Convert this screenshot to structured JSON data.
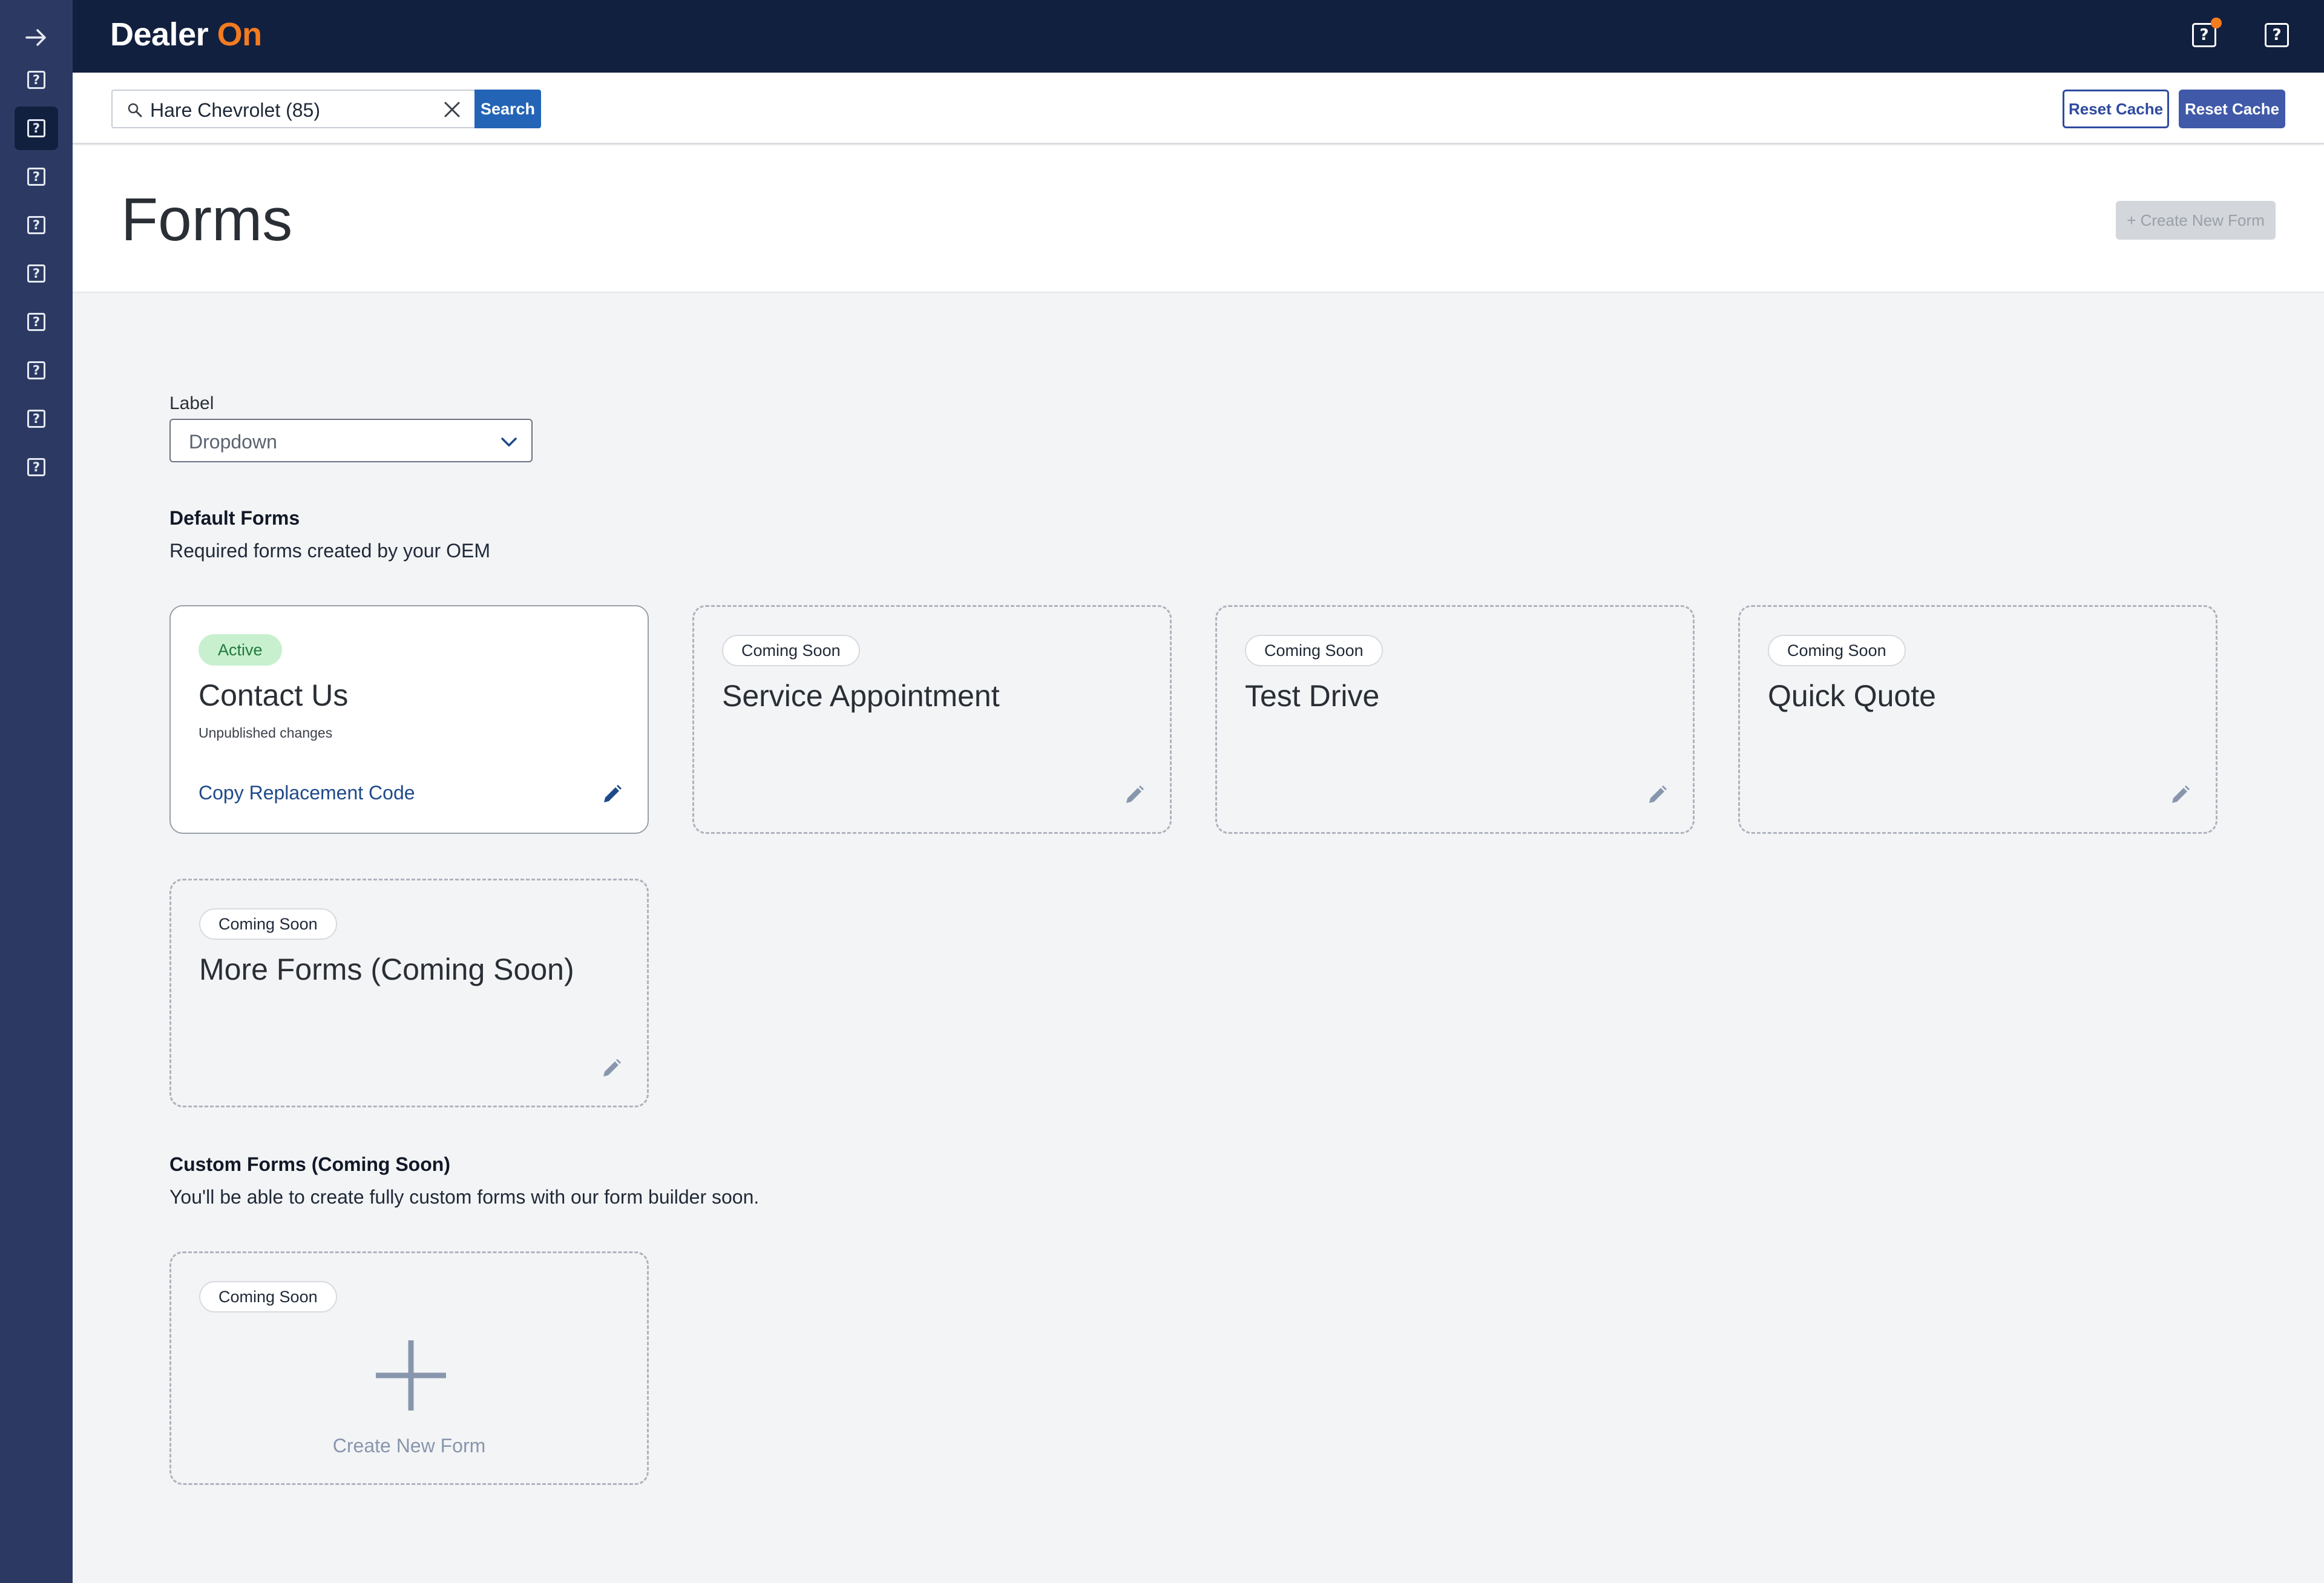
{
  "sidebar": {
    "collapse_icon": "arrow-right-icon",
    "item_icon": "help-square-icon",
    "item_count": 9,
    "active_index": 1
  },
  "header": {
    "logo_text_1": "Dealer",
    "logo_text_2": "On",
    "logo_colors": {
      "primary": "#ffffff",
      "accent": "#f47b20"
    },
    "icons": [
      "help-square-icon",
      "help-square-icon"
    ],
    "notification_dot_color": "#f47b20"
  },
  "search": {
    "value": "Hare Chevrolet (85)",
    "button_label": "Search"
  },
  "toolbar": {
    "reset_cache_label_1": "Reset Cache",
    "reset_cache_label_2": "Reset Cache"
  },
  "page": {
    "title": "Forms",
    "create_new_label": "+ Create New Form"
  },
  "filter": {
    "label": "Label",
    "dropdown_value": "Dropdown"
  },
  "default_forms": {
    "title": "Default Forms",
    "subtitle": "Required forms created by your OEM",
    "cards": [
      {
        "badge": "Active",
        "title": "Contact Us",
        "note": "Unpublished changes",
        "link": "Copy Replacement Code"
      },
      {
        "badge": "Coming Soon",
        "title": "Service Appointment"
      },
      {
        "badge": "Coming Soon",
        "title": "Test Drive"
      },
      {
        "badge": "Coming Soon",
        "title": "Quick Quote"
      },
      {
        "badge": "Coming Soon",
        "title": "More Forms (Coming Soon)"
      }
    ]
  },
  "custom_forms": {
    "title": "Custom Forms (Coming Soon)",
    "subtitle": "You'll be able to create fully custom forms with our form builder soon.",
    "card": {
      "badge": "Coming Soon",
      "label": "Create New Form"
    }
  },
  "colors": {
    "sidebar": "#2c3a63",
    "header": "#12203f",
    "primary_button": "#2364b6",
    "active_badge": "#c8f0cf"
  }
}
